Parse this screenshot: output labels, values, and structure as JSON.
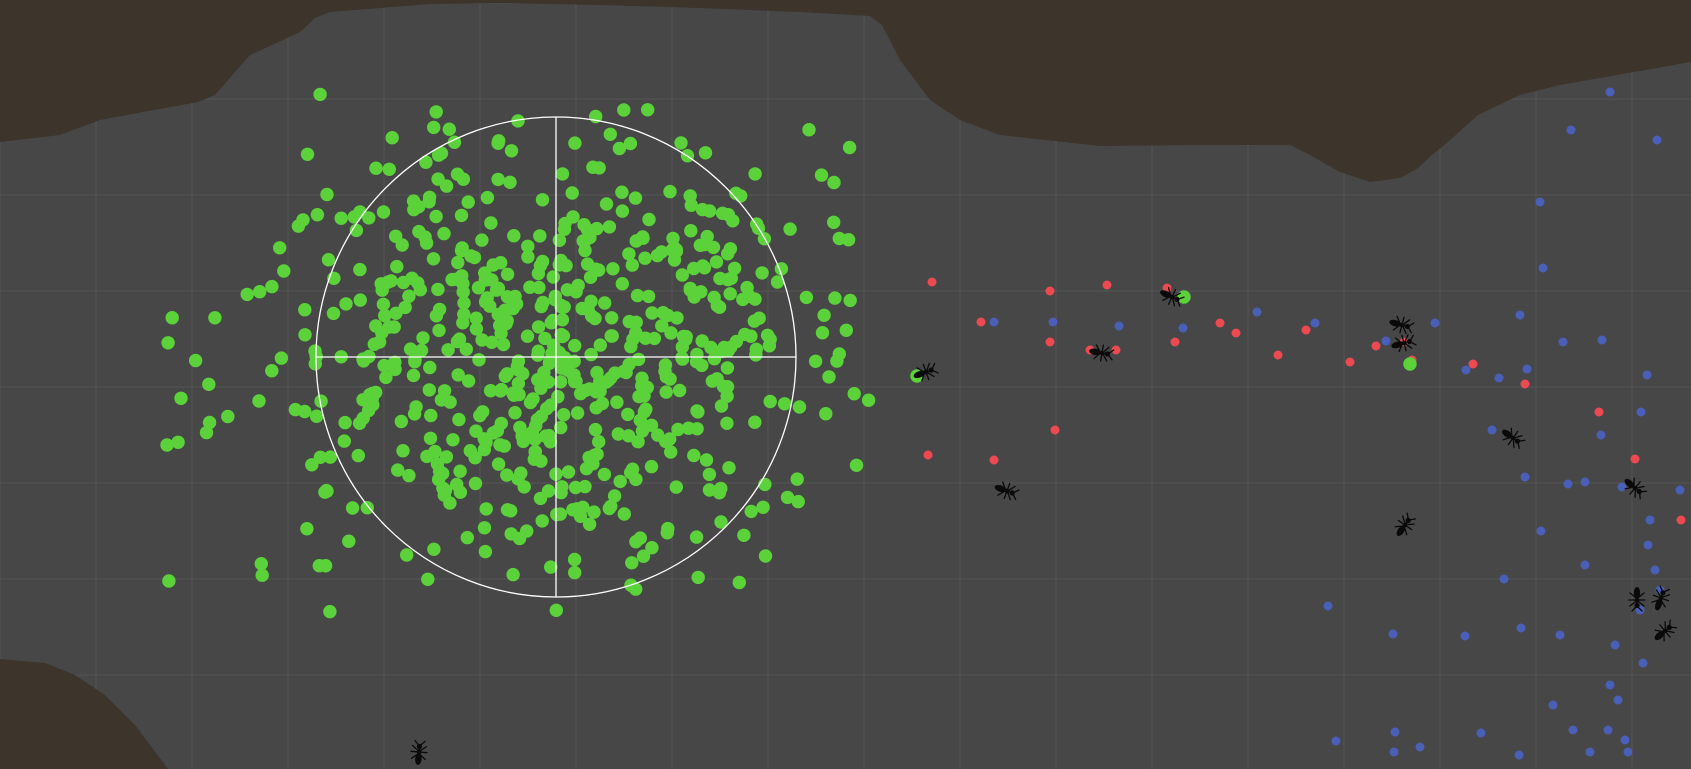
{
  "colors": {
    "background": "#474747",
    "grid": "#565656",
    "rock": "#3d342b",
    "food": "#5bd23a",
    "home_pheromone": "#4a5fb8",
    "food_pheromone": "#ec4a50",
    "ant": "#0a0a0a",
    "gizmo": "#ffffff"
  },
  "icons": {
    "ant": "ant-icon",
    "food": "food-pellet-icon",
    "target": "crosshair-icon"
  },
  "scene": {
    "food_cluster": {
      "pellet_count": 650,
      "has_crosshair_gizmo": true
    },
    "ant_count": 13,
    "pheromone_layers": [
      "food_pheromone",
      "home_pheromone"
    ]
  }
}
